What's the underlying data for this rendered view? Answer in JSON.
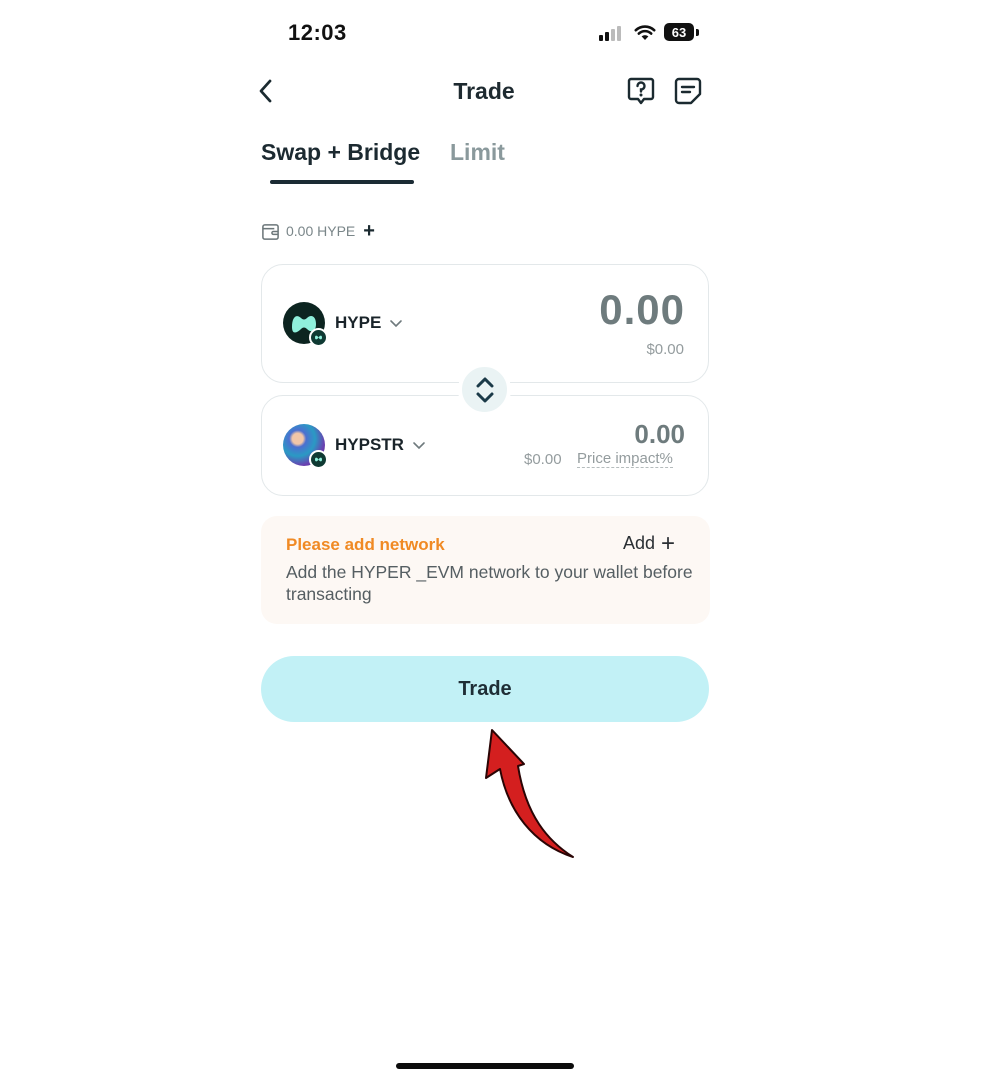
{
  "status_bar": {
    "time": "12:03",
    "battery": "63"
  },
  "header": {
    "title": "Trade"
  },
  "tabs": [
    {
      "label": "Swap + Bridge",
      "active": true
    },
    {
      "label": "Limit",
      "active": false
    }
  ],
  "balance": {
    "text": "0.00 HYPE",
    "add_label": "+"
  },
  "from": {
    "symbol": "HYPE",
    "amount": "0.00",
    "usd": "$0.00",
    "icon": "hype-token-icon"
  },
  "to": {
    "symbol": "HYPSTR",
    "amount": "0.00",
    "usd": "$0.00",
    "price_impact_label": "Price impact%",
    "icon": "hypstr-token-icon"
  },
  "notice": {
    "title": "Please add network",
    "add_label": "Add",
    "body": "Add the HYPER _EVM network to your wallet before transacting"
  },
  "trade_button": {
    "label": "Trade"
  },
  "colors": {
    "accent": "#c2f1f6",
    "warning": "#f08a24",
    "arrow": "#d41f1f"
  }
}
